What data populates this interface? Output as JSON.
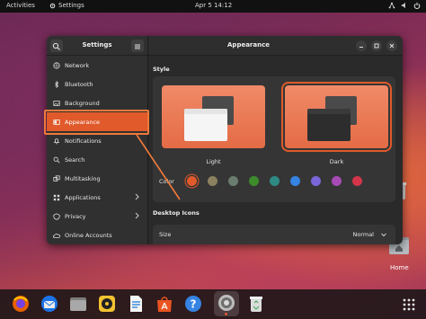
{
  "topbar": {
    "activities": "Activities",
    "app_name": "Settings",
    "clock": "Apr 5  14:12"
  },
  "sidebar": {
    "title": "Settings",
    "items": [
      {
        "label": "Network",
        "icon": "network-icon"
      },
      {
        "label": "Bluetooth",
        "icon": "bluetooth-icon"
      },
      {
        "label": "Background",
        "icon": "background-icon"
      },
      {
        "label": "Appearance",
        "icon": "appearance-icon",
        "active": true
      },
      {
        "label": "Notifications",
        "icon": "bell-icon"
      },
      {
        "label": "Search",
        "icon": "search-icon"
      },
      {
        "label": "Multitasking",
        "icon": "multitasking-icon"
      },
      {
        "label": "Applications",
        "icon": "applications-icon",
        "has_submenu": true
      },
      {
        "label": "Privacy",
        "icon": "privacy-icon",
        "has_submenu": true
      },
      {
        "label": "Online Accounts",
        "icon": "cloud-icon"
      }
    ]
  },
  "main": {
    "title": "Appearance",
    "style_section": "Style",
    "light_label": "Light",
    "dark_label": "Dark",
    "selected_style": "Dark",
    "color_label": "Color",
    "colors": [
      "#e05a2b",
      "#8b8160",
      "#6a7d6e",
      "#3c8c2c",
      "#2f8a85",
      "#3584e4",
      "#7a66d8",
      "#a64bb5",
      "#d4354a"
    ],
    "selected_color_index": 0,
    "desktop_icons_section": "Desktop Icons",
    "size_label": "Size",
    "size_value": "Normal"
  },
  "desktop": {
    "home_label": "Home"
  },
  "dock": {
    "apps": [
      "firefox-icon",
      "thunderbird-icon",
      "files-icon",
      "rhythmbox-icon",
      "writer-icon",
      "app-center-icon",
      "help-icon",
      "settings-icon",
      "trash-icon"
    ],
    "active_app": "settings-icon"
  },
  "colors": {
    "accent": "#e05a2b",
    "annotation": "#f07a3a"
  }
}
